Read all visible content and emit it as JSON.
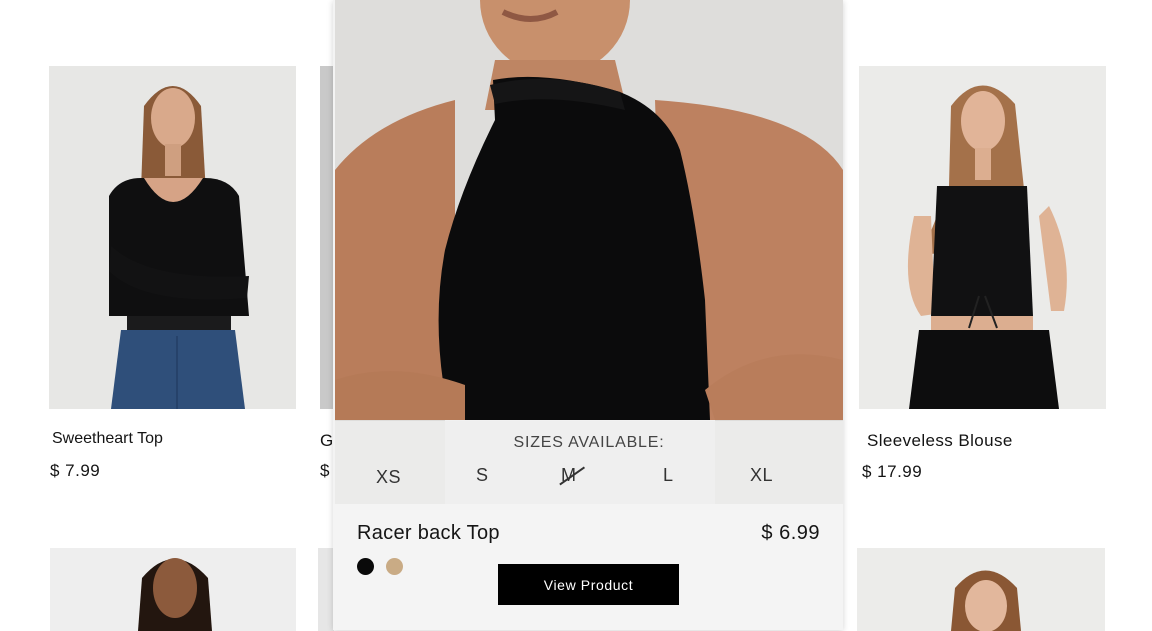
{
  "products": [
    {
      "name": "Sweetheart Top",
      "price": "$ 7.99"
    },
    {
      "name": "G",
      "price": "$"
    },
    {
      "name": "Sleeveless Blouse",
      "price": "$ 17.99"
    }
  ],
  "featured": {
    "sizes_label": "SIZES AVAILABLE:",
    "sizes": [
      "XS",
      "S",
      "M",
      "L",
      "XL"
    ],
    "unavailable_size": "M",
    "name": "Racer back Top",
    "price": "$ 6.99",
    "colors": [
      "#0a0a0a",
      "#c9ab85"
    ],
    "button_label": "View Product"
  },
  "icons": {
    "swatch_black": "color-swatch-black",
    "swatch_beige": "color-swatch-beige"
  }
}
